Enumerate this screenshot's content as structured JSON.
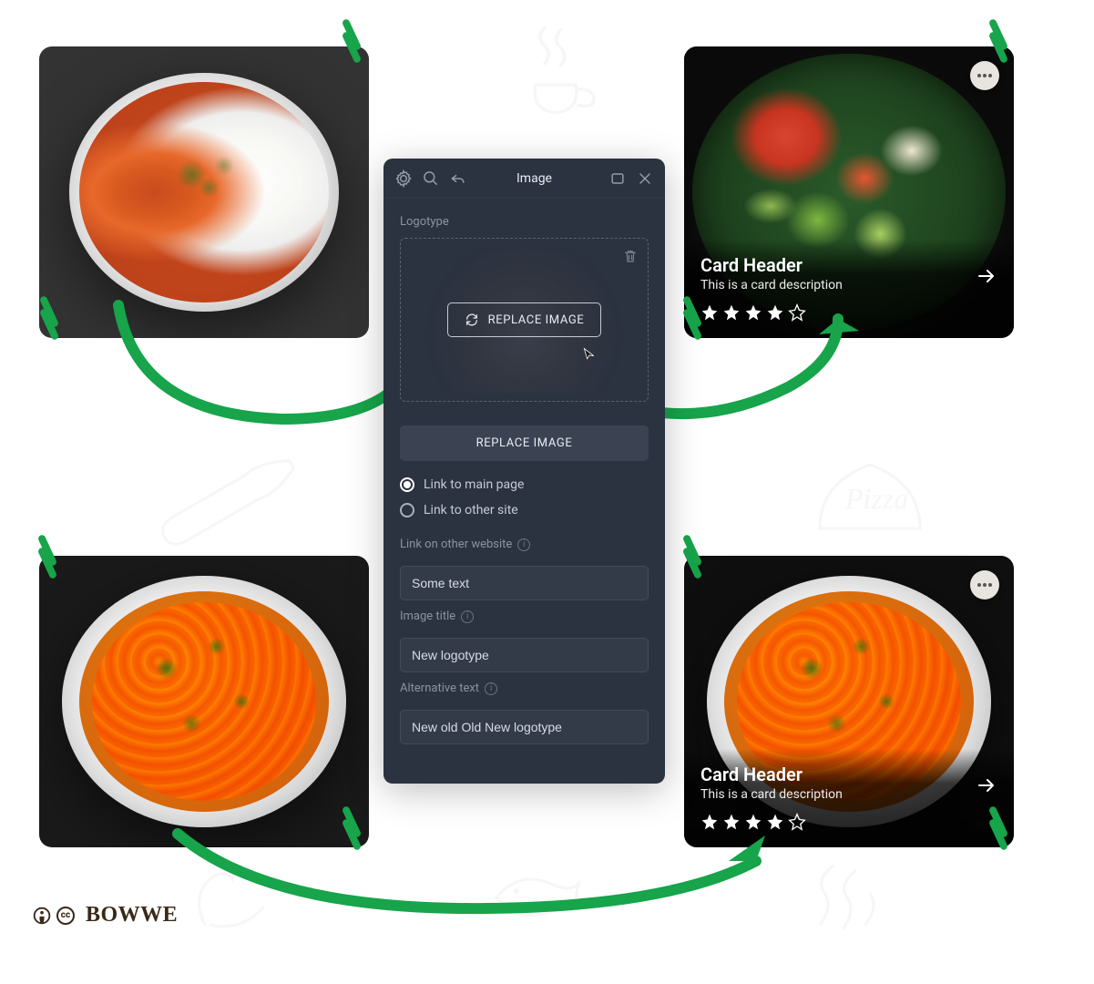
{
  "panel": {
    "title": "Image",
    "section_label": "Logotype",
    "replace_inline": "REPLACE IMAGE",
    "replace_block": "REPLACE IMAGE",
    "link_main": "Link to main page",
    "link_other": "Link to other site",
    "link_website_label": "Link on other website",
    "link_website_value": "Some text",
    "image_title_label": "Image title",
    "image_title_value": "New logotype",
    "alt_label": "Alternative text",
    "alt_value": "New old Old New logotype"
  },
  "cards": {
    "top_right": {
      "header": "Card Header",
      "desc": "This is a card description",
      "rating": 4
    },
    "bottom_right": {
      "header": "Card Header",
      "desc": "This is a card description",
      "rating": 4
    }
  },
  "brand": "BOWWE",
  "cc": {
    "by": "i",
    "cc": "cc"
  }
}
